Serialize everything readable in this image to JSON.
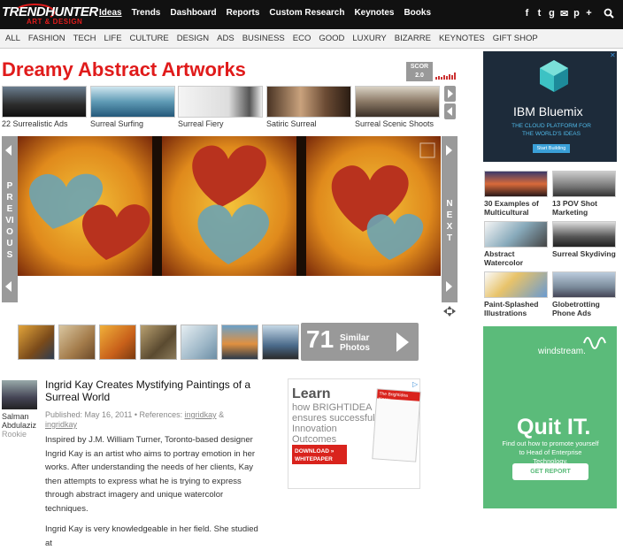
{
  "header": {
    "logo_top": "TRENDHUNTER",
    "logo_bottom": "ART & DESIGN",
    "nav": [
      "Ideas",
      "Trends",
      "Dashboard",
      "Reports",
      "Custom Research",
      "Keynotes",
      "Books"
    ],
    "social_icons": [
      "facebook-icon",
      "twitter-icon",
      "google-plus-icon",
      "email-icon",
      "pinterest-icon",
      "plus-icon"
    ],
    "social_glyphs": [
      "f",
      "t",
      "g",
      "✉",
      "p",
      "+"
    ]
  },
  "categories": [
    "ALL",
    "FASHION",
    "TECH",
    "LIFE",
    "CULTURE",
    "DESIGN",
    "ADS",
    "BUSINESS",
    "ECO",
    "GOOD",
    "LUXURY",
    "BIZARRE",
    "KEYNOTES",
    "GIFT SHOP"
  ],
  "article": {
    "title": "Dreamy Abstract Artworks",
    "score_label": "SCOR",
    "score_value": "2.0",
    "related": [
      "22 Surrealistic Ads",
      "Surreal Surfing",
      "Surreal Fiery",
      "Satiric Surreal",
      "Surreal Scenic Shoots"
    ],
    "prev_label": "PREVIOUS",
    "next_label": "NEXT",
    "similar_count": "71",
    "similar_label_1": "Similar",
    "similar_label_2": "Photos",
    "author_name_1": "Salman",
    "author_name_2": "Abdulaziz",
    "author_rank": "Rookie",
    "headline": "Ingrid Kay Creates Mystifying Paintings of a Surreal World",
    "meta_published": "Published: May 16, 2011 • References: ",
    "meta_ref1": "ingridkay",
    "meta_amp": " & ",
    "meta_ref2": "ingridkay",
    "body_1": "Inspired by J.M. William Turner, Toronto-based designer Ingrid Kay is an artist who aims to portray emotion in her works. After understanding the needs of her clients, Kay then attempts to express what he is trying to express through abstract imagery and unique watercolor techniques.",
    "body_2": "Ingrid Kay is very knowledgeable in her field. She studied at"
  },
  "ad_inline": {
    "learn": "Learn",
    "line1": "how BRIGHTIDEA",
    "line2": "ensures successful",
    "line3": "Innovation",
    "line4": "Outcomes",
    "button": "DOWNLOAD » WHITEPAPER",
    "doc_title": "The Brightidea Know"
  },
  "ad_ibm": {
    "title": "IBM Bluemix",
    "subtitle": "THE CLOUD PLATFORM FOR THE WORLD'S IDEAS",
    "button": "Start Building"
  },
  "right_trends": [
    "30 Examples of Multicultural",
    "13 POV Shot Marketing",
    "Abstract Watercolor",
    "Surreal Skydiving",
    "Paint-Splashed Illustrations",
    "Globetrotting Phone Ads"
  ],
  "ad_windstream": {
    "brand": "windstream.",
    "headline": "Quit IT.",
    "subtitle": "Find out how to promote yourself to Head of Enterprise Technology.",
    "button": "GET REPORT"
  },
  "colors": {
    "brand_red": "#e01b1b",
    "topbar": "#111111",
    "gray_button": "#999999",
    "ad_green": "#5bbb7a"
  }
}
